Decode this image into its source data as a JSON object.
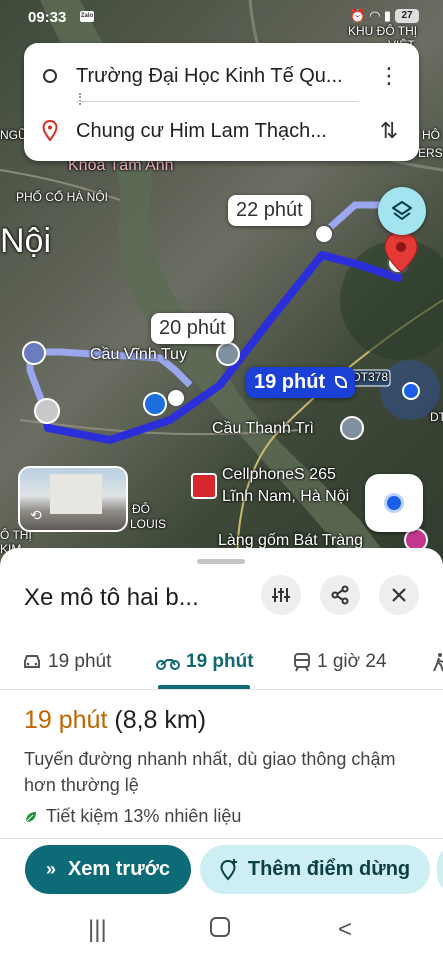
{
  "status": {
    "time": "09:33",
    "zalo": "Zalo",
    "battery": "27"
  },
  "map": {
    "labels": [
      "KHU ĐÔ THỊ",
      "VIỆT",
      "Khoa Tâm Anh",
      "PHỐ CỔ HÀ NỘI",
      "Nội",
      "Cầu Vĩnh Tuy",
      "Cầu Thanh Trì",
      "CellphoneS 265",
      "Lĩnh Nam, Hà Nội",
      "Làng gốm Bát Tràng",
      "DT378",
      "ĐÔ",
      "LOUIS",
      "Ô THỊ",
      "KIM",
      "NGỮ",
      "HÔ",
      "ERS",
      "DT"
    ],
    "route_times": {
      "alt1": "22 phút",
      "alt2": "20 phút",
      "selected": "19 phút"
    }
  },
  "route_card": {
    "origin": "Trường Đại Học Kinh Tế Qu...",
    "destination": "Chung cư Him Lam Thạch...",
    "more_icon": "⋮",
    "swap_icon": "⇅"
  },
  "sheet": {
    "title": "Xe mô tô hai b...",
    "tabs": [
      {
        "label": "19 phút",
        "icon": "car-icon"
      },
      {
        "label": "19 phút",
        "icon": "motorbike-icon"
      },
      {
        "label": "1 giờ 24",
        "icon": "transit-icon"
      },
      {
        "label": "",
        "icon": "walk-icon"
      }
    ],
    "eta_time": "19 phút",
    "eta_distance": "(8,8 km)",
    "description": "Tuyến đường nhanh nhất, dù giao thông chậm hơn thường lệ",
    "eco_text": "Tiết kiệm 13% nhiên liệu",
    "preview_button": "Xem trước",
    "add_stop_button": "Thêm điểm dừng"
  },
  "colors": {
    "accent": "#0d6b78",
    "eta": "#c26401",
    "route": "#2b2fd9",
    "selected_bubble": "#1a40d6"
  }
}
